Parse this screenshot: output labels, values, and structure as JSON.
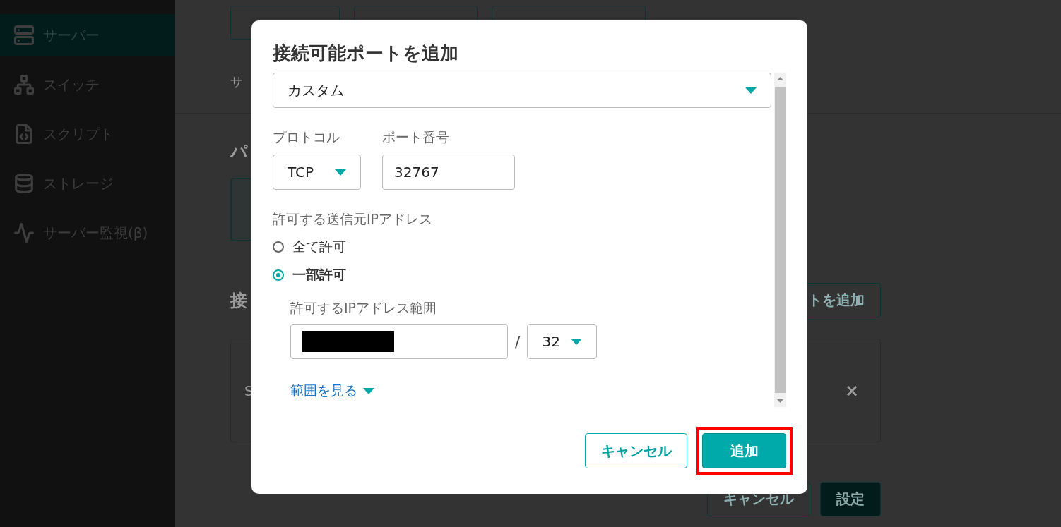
{
  "sidebar": {
    "items": [
      {
        "label": "サーバー",
        "selected": true
      },
      {
        "label": "スイッチ",
        "selected": false
      },
      {
        "label": "スクリプト",
        "selected": false
      },
      {
        "label": "ストレージ",
        "selected": false
      },
      {
        "label": "サーバー監視(β)",
        "selected": false
      }
    ]
  },
  "background": {
    "breadcrumb_fragment": "サ",
    "section_fragment": "パ",
    "section2_fragment": "接",
    "add_port_button_fragment": "トを追加",
    "row_fragment": "S",
    "remove_icon": "×",
    "buttons": [
      {
        "label": "キャンセル",
        "kind": "outline"
      },
      {
        "label": "設定",
        "kind": "primary"
      }
    ]
  },
  "dialog": {
    "title": "接続可能ポートを追加",
    "preset_select": {
      "value": "カスタム"
    },
    "protocol": {
      "label": "プロトコル",
      "value": "TCP"
    },
    "port": {
      "label": "ポート番号",
      "value": "32767"
    },
    "source": {
      "label": "許可する送信元IPアドレス",
      "options": [
        {
          "label": "全て許可",
          "selected": false
        },
        {
          "label": "一部許可",
          "selected": true
        }
      ]
    },
    "range": {
      "label": "許可するIPアドレス範囲",
      "redacted": true,
      "separator": "/",
      "prefix": "32"
    },
    "show_range_link": "範囲を見る",
    "buttons": [
      {
        "label": "キャンセル",
        "kind": "outline",
        "highlighted": false
      },
      {
        "label": "追加",
        "kind": "primary",
        "highlighted": true
      }
    ]
  }
}
